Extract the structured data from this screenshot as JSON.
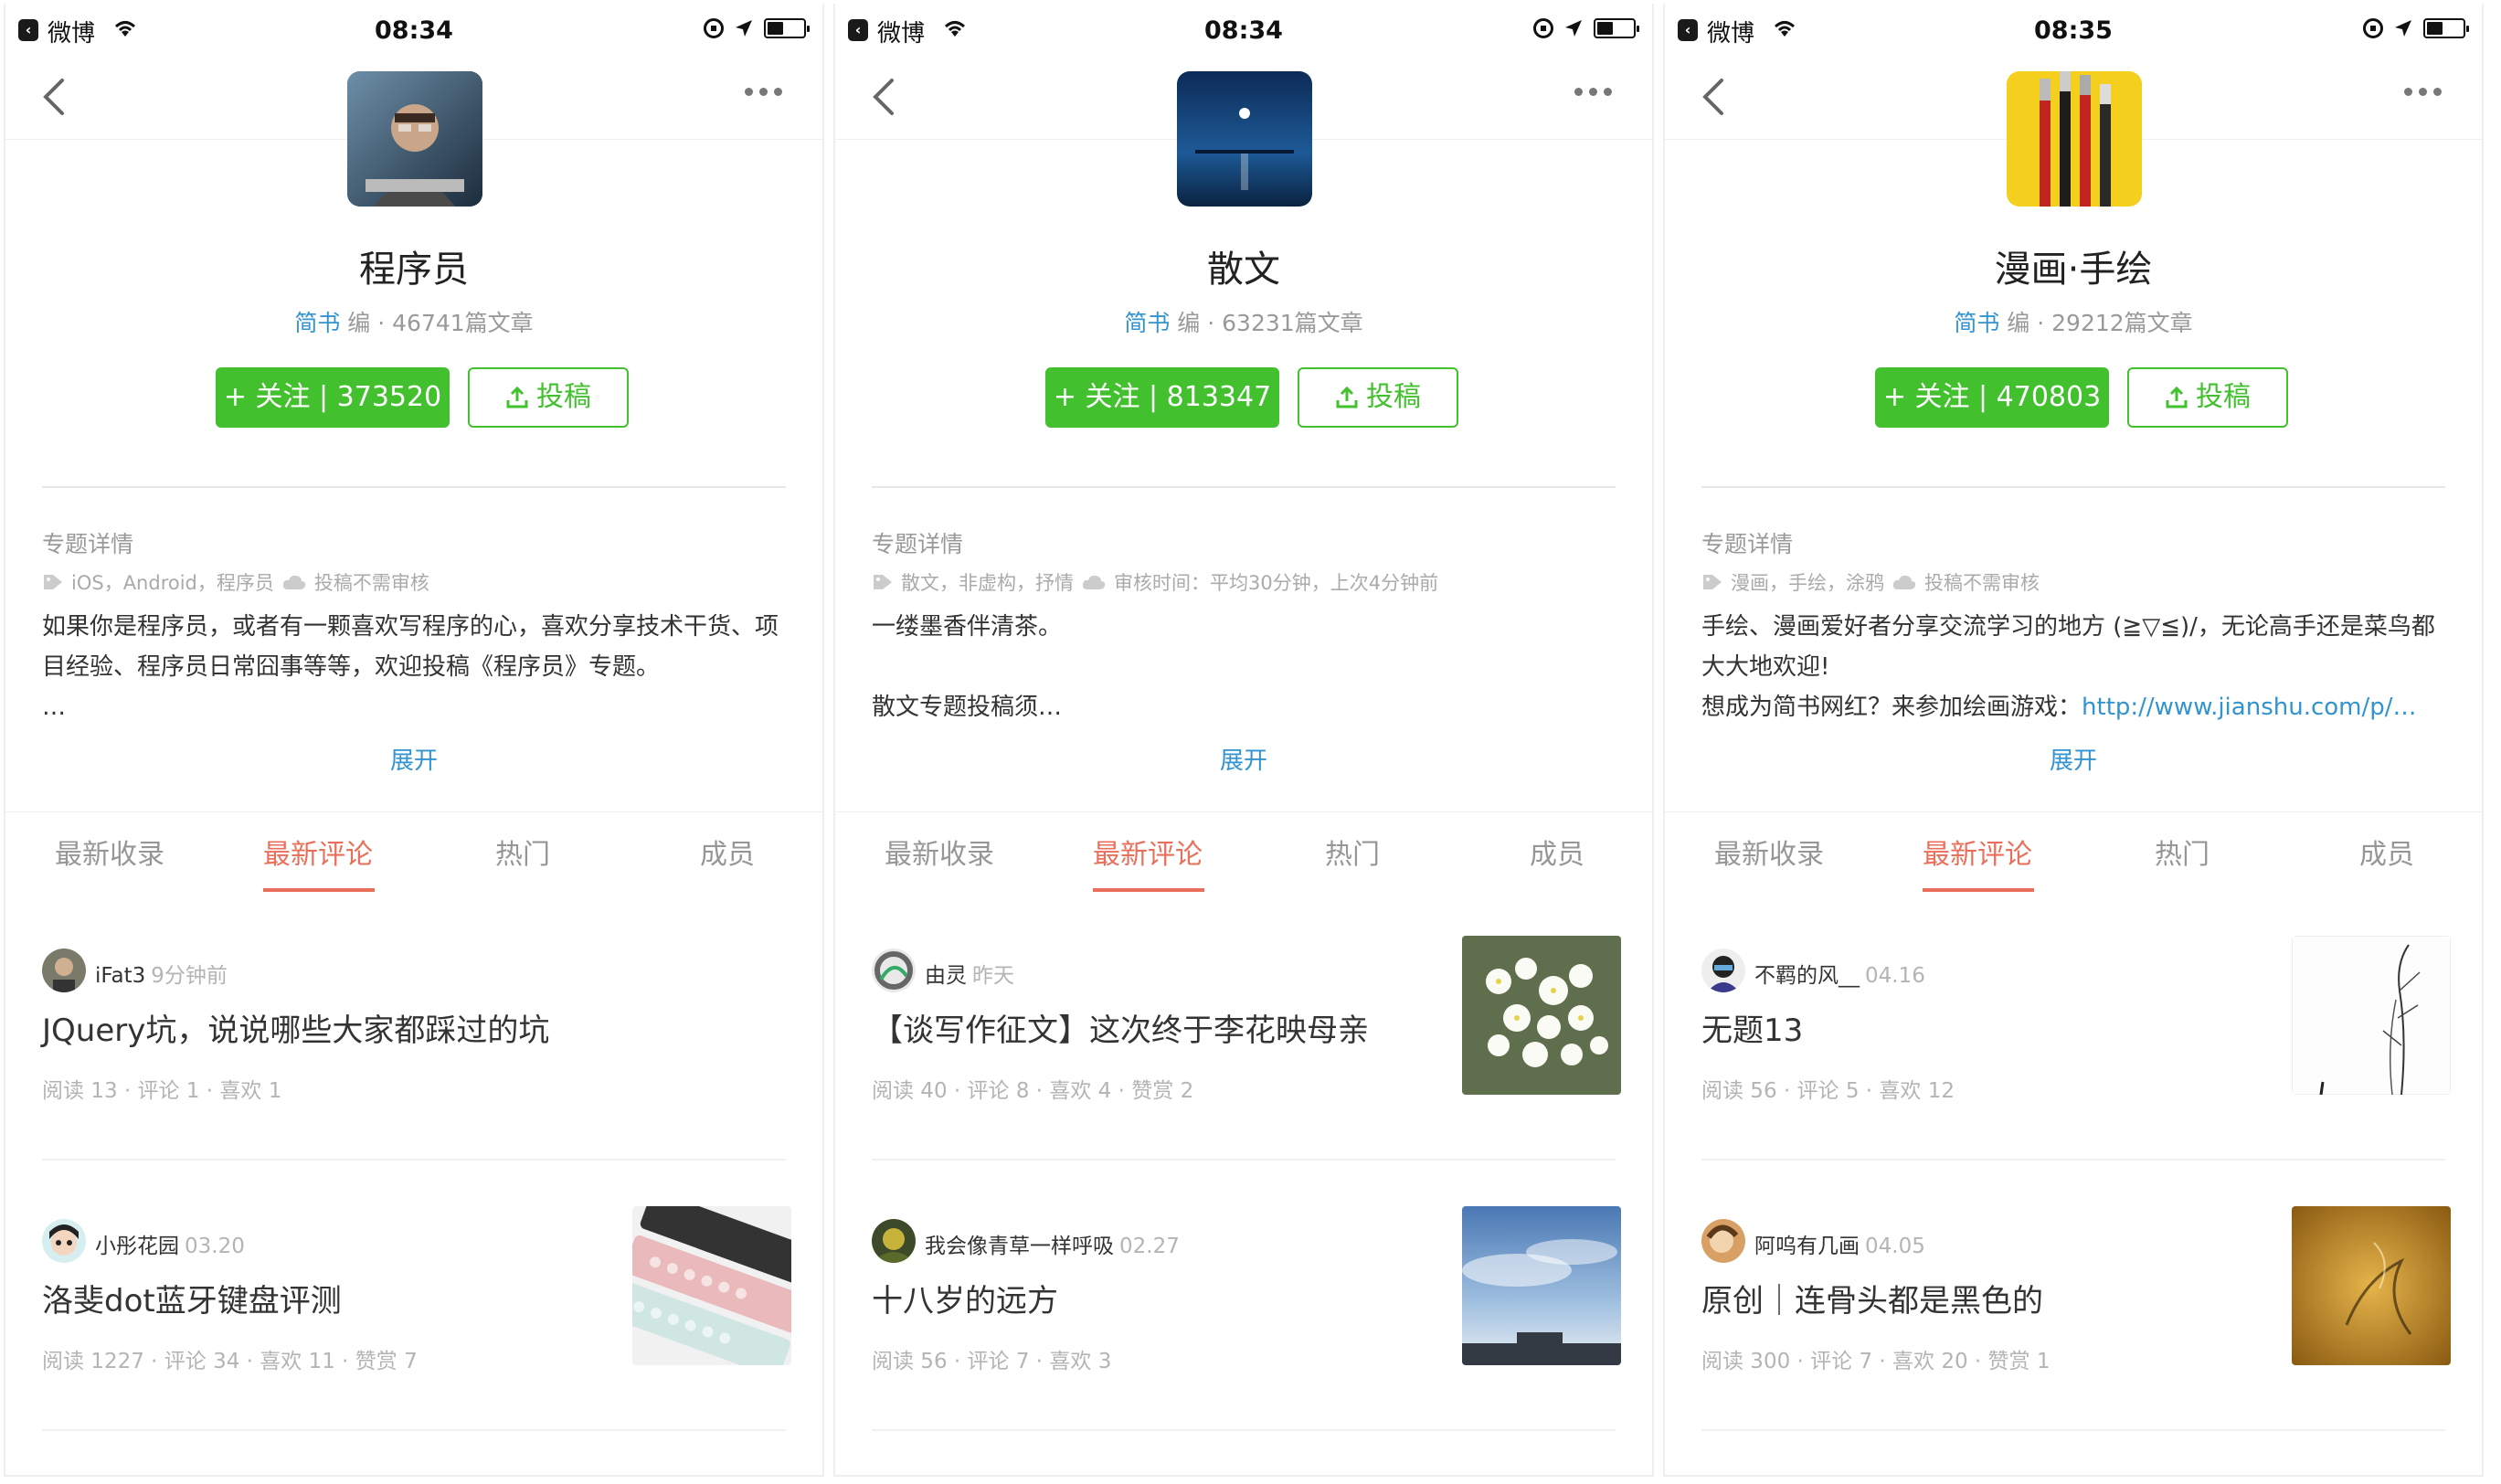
{
  "colors": {
    "accent_green": "#42c02e",
    "link_blue": "#3194d0",
    "tab_active": "#ea6f5a",
    "muted": "#969696"
  },
  "screens": [
    {
      "status": {
        "back_app": "微博",
        "time": "08:34"
      },
      "title": "程序员",
      "meta": {
        "editor": "简书",
        "rest": " 编 · 46741篇文章"
      },
      "follow": "+ 关注 | 373520",
      "submit": "投稿",
      "detail_head": "专题详情",
      "tags": "iOS，Android，程序员",
      "audit": "投稿不需审核",
      "desc": "如果你是程序员，或者有一颗喜欢写程序的心，喜欢分享技术干货、项目经验、程序员日常囧事等等，欢迎投稿《程序员》专题。\n…",
      "expand": "展开",
      "tabs": [
        "最新收录",
        "最新评论",
        "热门",
        "成员"
      ],
      "articles": [
        {
          "author": "iFat3",
          "time": "9分钟前",
          "title": "JQuery坑，说说哪些大家都踩过的坑",
          "stats": "阅读 13 · 评论 1 · 喜欢 1",
          "thumb": ""
        },
        {
          "author": "小彤花园",
          "time": "03.20",
          "title": "洛斐dot蓝牙键盘评测",
          "stats": "阅读 1227 · 评论 34 · 喜欢 11 · 赞赏 7",
          "thumb": "keyboard"
        }
      ]
    },
    {
      "status": {
        "back_app": "微博",
        "time": "08:34"
      },
      "title": "散文",
      "meta": {
        "editor": "简书",
        "rest": " 编 · 63231篇文章"
      },
      "follow": "+ 关注 | 813347",
      "submit": "投稿",
      "detail_head": "专题详情",
      "tags": "散文，非虚构，抒情",
      "audit": "审核时间：平均30分钟，上次4分钟前",
      "desc": "一缕墨香伴清茶。\n\n散文专题投稿须…",
      "expand": "展开",
      "tabs": [
        "最新收录",
        "最新评论",
        "热门",
        "成员"
      ],
      "articles": [
        {
          "author": "由灵",
          "time": "昨天",
          "title": "【谈写作征文】这次终于李花映母亲",
          "stats": "阅读 40 · 评论 8 · 喜欢 4 · 赞赏 2",
          "thumb": "flowers"
        },
        {
          "author": "我会像青草一样呼吸",
          "time": "02.27",
          "title": "十八岁的远方",
          "stats": "阅读 56 · 评论 7 · 喜欢 3",
          "thumb": "sky"
        }
      ]
    },
    {
      "status": {
        "back_app": "微博",
        "time": "08:35"
      },
      "title": "漫画·手绘",
      "meta": {
        "editor": "简书",
        "rest": " 编 · 29212篇文章"
      },
      "follow": "+ 关注 | 470803",
      "submit": "投稿",
      "detail_head": "专题详情",
      "tags": "漫画，手绘，涂鸦",
      "audit": "投稿不需审核",
      "desc_line1": "手绘、漫画爱好者分享交流学习的地方 (≧▽≦)/，无论高手还是菜鸟都大大地欢迎!",
      "desc_line2": "想成为简书网红？来参加绘画游戏：",
      "desc_link": "http://www.jianshu.com/p/…",
      "expand": "展开",
      "tabs": [
        "最新收录",
        "最新评论",
        "热门",
        "成员"
      ],
      "articles": [
        {
          "author": "不羁的风__",
          "time": "04.16",
          "title": "无题13",
          "stats": "阅读 56 · 评论 5 · 喜欢 12",
          "thumb": "ink"
        },
        {
          "author": "阿呜有几画",
          "time": "04.05",
          "title": "原创｜连骨头都是黑色的",
          "stats": "阅读 300 · 评论 7 · 喜欢 20 · 赞赏 1",
          "thumb": "gold"
        }
      ]
    }
  ]
}
